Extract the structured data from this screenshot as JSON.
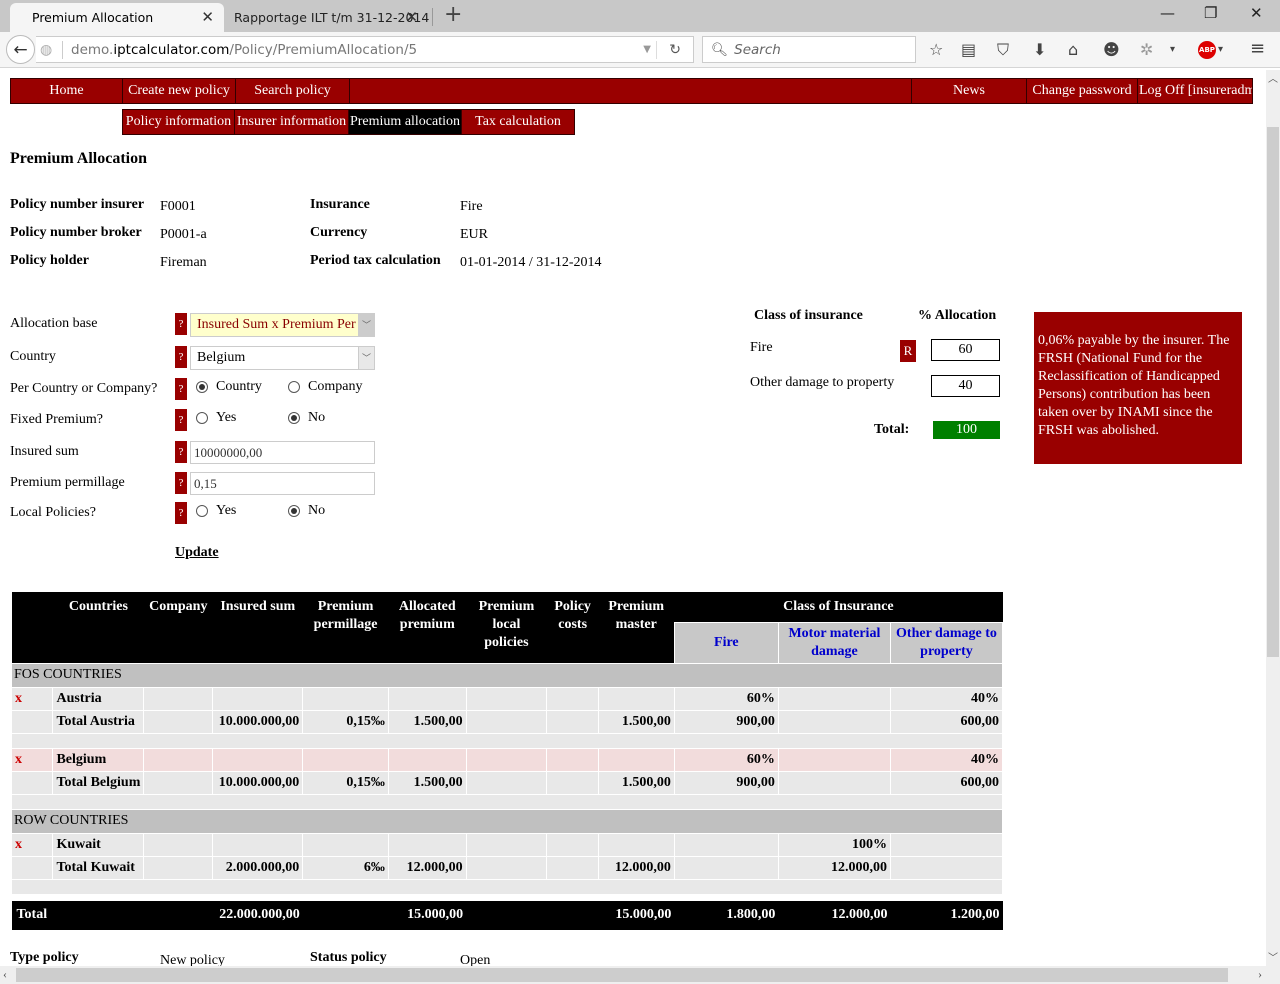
{
  "browser": {
    "tabs": [
      {
        "label": "Premium Allocation",
        "active": true
      },
      {
        "label": "Rapportage ILT t/m 31-12-2014",
        "active": false
      }
    ],
    "url_prefix": "demo.",
    "url_host": "iptcalculator.com",
    "url_path": "/Policy/PremiumAllocation/5",
    "search_placeholder": "Search",
    "abp_label": "ABP"
  },
  "mainnav": {
    "items": [
      "Home",
      "Create new policy",
      "Search policy",
      "News",
      "Change password",
      "Log Off [insureradm"
    ]
  },
  "subnav": {
    "items": [
      "Policy information",
      "Insurer information",
      "Premium allocation",
      "Tax calculation"
    ],
    "active": "Premium allocation"
  },
  "page_title": "Premium Allocation",
  "policy_info": {
    "policy_number_insurer_label": "Policy number insurer",
    "policy_number_insurer": "F0001",
    "policy_number_broker_label": "Policy number broker",
    "policy_number_broker": "P0001-a",
    "policy_holder_label": "Policy holder",
    "policy_holder": "Fireman",
    "insurance_label": "Insurance",
    "insurance": "Fire",
    "currency_label": "Currency",
    "currency": "EUR",
    "period_label": "Period tax calculation",
    "period": "01-01-2014 / 31-12-2014"
  },
  "form": {
    "help_glyph": "?",
    "allocation_base_label": "Allocation base",
    "allocation_base_value": "Insured Sum x Premium Per",
    "country_label": "Country",
    "country_value": "Belgium",
    "per_country_label": "Per Country or Company?",
    "per_country_options": [
      "Country",
      "Company"
    ],
    "per_country_selected": "Country",
    "fixed_premium_label": "Fixed Premium?",
    "fixed_premium_options": [
      "Yes",
      "No"
    ],
    "fixed_premium_selected": "No",
    "insured_sum_label": "Insured sum",
    "insured_sum_value": "10000000,00",
    "premium_permillage_label": "Premium permillage",
    "premium_permillage_value": "0,15",
    "local_policies_label": "Local Policies?",
    "local_policies_options": [
      "Yes",
      "No"
    ],
    "local_policies_selected": "No",
    "update_label": "Update"
  },
  "allocation": {
    "class_header": "Class of insurance",
    "pct_header": "% Allocation",
    "rows": [
      {
        "class": "Fire",
        "pct": "60",
        "r_button": "R"
      },
      {
        "class": "Other damage to property",
        "pct": "40"
      }
    ],
    "total_label": "Total:",
    "total_value": "100"
  },
  "note": "0,06% payable by the insurer. The FRSH (National Fund for the Reclassification of Handicapped Persons) contribution has been taken over by INAMI since the FRSH was abolished.",
  "table": {
    "headers": [
      "",
      "Countries",
      "Company",
      "Insured sum",
      "Premium permillage",
      "Allocated premium",
      "Premium local policies",
      "Policy costs",
      "Premium master"
    ],
    "class_header": "Class of Insurance",
    "class_columns": [
      "Fire",
      "Motor material damage",
      "Other damage to property"
    ],
    "groups": [
      {
        "name": "FOS COUNTRIES",
        "countries": [
          {
            "delete": "x",
            "country": "Austria",
            "pcts": [
              "60%",
              "",
              "40%"
            ],
            "total": {
              "label": "Total Austria",
              "insured_sum": "10.000.000,00",
              "permillage": "0,15‰",
              "allocated": "1.500,00",
              "local": "",
              "costs": "",
              "master": "1.500,00",
              "classes": [
                "900,00",
                "",
                "600,00"
              ]
            }
          },
          {
            "delete": "x",
            "country": "Belgium",
            "highlight": true,
            "pcts": [
              "60%",
              "",
              "40%"
            ],
            "total": {
              "label": "Total Belgium",
              "insured_sum": "10.000.000,00",
              "permillage": "0,15‰",
              "allocated": "1.500,00",
              "local": "",
              "costs": "",
              "master": "1.500,00",
              "classes": [
                "900,00",
                "",
                "600,00"
              ]
            }
          }
        ]
      },
      {
        "name": "ROW COUNTRIES",
        "countries": [
          {
            "delete": "x",
            "country": "Kuwait",
            "pcts": [
              "",
              "100%",
              ""
            ],
            "total": {
              "label": "Total Kuwait",
              "insured_sum": "2.000.000,00",
              "permillage": "6‰",
              "allocated": "12.000,00",
              "local": "",
              "costs": "",
              "master": "12.000,00",
              "classes": [
                "",
                "12.000,00",
                ""
              ]
            }
          }
        ]
      }
    ],
    "grand_total": {
      "label": "Total",
      "insured_sum": "22.000.000,00",
      "allocated": "15.000,00",
      "master": "15.000,00",
      "classes": [
        "1.800,00",
        "12.000,00",
        "1.200,00"
      ]
    }
  },
  "footer": {
    "type_policy_label": "Type policy",
    "type_policy": "New policy",
    "status_policy_label": "Status policy",
    "status_policy": "Open"
  }
}
